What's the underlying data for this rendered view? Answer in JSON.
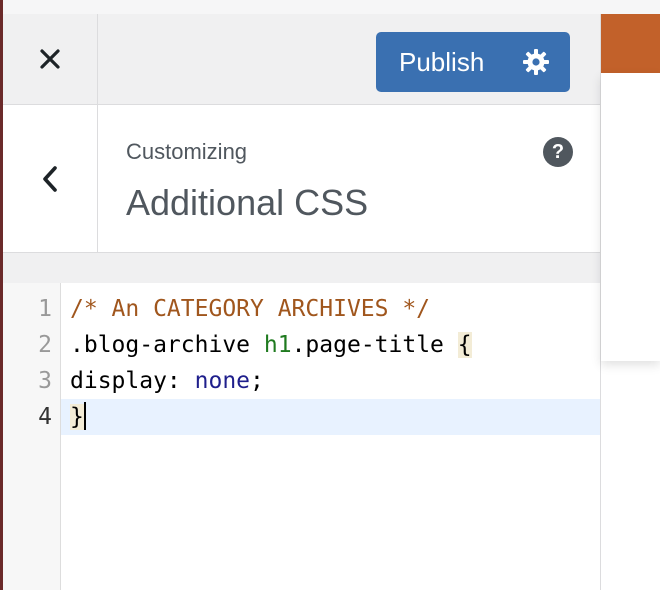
{
  "header": {
    "close_icon": "close-icon",
    "publish_label": "Publish",
    "publish_settings_icon": "gear-icon",
    "colors": {
      "publish_bg": "#3a70b1",
      "preview_accent": "#c2612a"
    }
  },
  "section": {
    "back_icon": "chevron-left-icon",
    "context_label": "Customizing",
    "title": "Additional CSS",
    "help_icon_glyph": "?"
  },
  "editor": {
    "line_numbers": [
      "1",
      "2",
      "3",
      "4"
    ],
    "active_line": 4,
    "lines": [
      {
        "tokens": [
          {
            "t": "comment",
            "v": "/* An CATEGORY ARCHIVES */"
          }
        ]
      },
      {
        "tokens": [
          {
            "t": "plain",
            "v": ".blog-archive "
          },
          {
            "t": "tag",
            "v": "h1"
          },
          {
            "t": "plain",
            "v": ".page-title "
          },
          {
            "t": "bracket",
            "v": "{"
          }
        ]
      },
      {
        "tokens": [
          {
            "t": "plain",
            "v": "display: "
          },
          {
            "t": "kw",
            "v": "none"
          },
          {
            "t": "plain",
            "v": ";"
          }
        ]
      },
      {
        "tokens": [
          {
            "t": "bracket",
            "v": "}"
          }
        ]
      }
    ]
  }
}
